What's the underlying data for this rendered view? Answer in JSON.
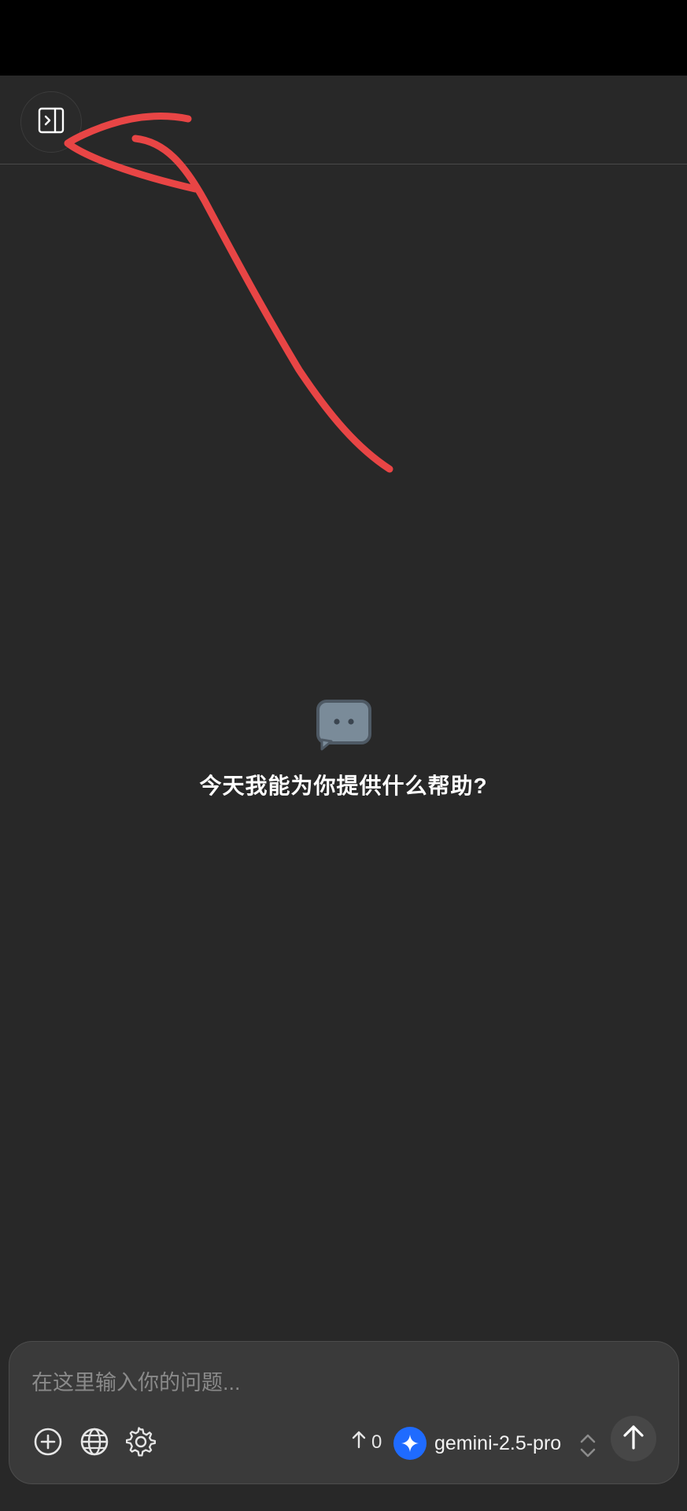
{
  "welcome": {
    "icon": "chat-bubble-icon",
    "message": "今天我能为你提供什么帮助?"
  },
  "composer": {
    "placeholder": "在这里输入你的问题...",
    "value": "",
    "tools": [
      "add-circle-icon",
      "globe-icon",
      "gear-icon"
    ],
    "token_count": "0",
    "model_name": "gemini-2.5-pro",
    "model_icon_color": "#1f6bff"
  },
  "colors": {
    "background": "#282828",
    "status_bar": "#000000",
    "annotation_stroke": "#e84545"
  }
}
